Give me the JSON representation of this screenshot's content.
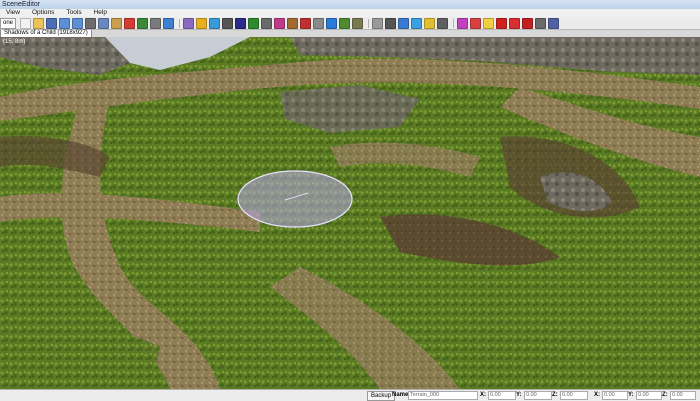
{
  "window": {
    "title": "SceneEditor"
  },
  "menu": [
    "View",
    "Options",
    "Tools",
    "Help"
  ],
  "toolbar": {
    "dropdown_value": "one",
    "buttons": [
      {
        "name": "new-icon",
        "color": "#f2f2f2"
      },
      {
        "name": "open-icon",
        "color": "#e9c35a"
      },
      {
        "name": "save-icon",
        "color": "#4b6fb5"
      },
      {
        "name": "undo-icon",
        "color": "#5d8fd6"
      },
      {
        "name": "redo-icon",
        "color": "#5d8fd6"
      },
      {
        "name": "cut-icon",
        "color": "#6d6d6d"
      },
      {
        "name": "copy-icon",
        "color": "#6a88c0"
      },
      {
        "name": "paste-icon",
        "color": "#caa050"
      },
      {
        "name": "delete-icon",
        "color": "#d53b32"
      },
      {
        "name": "zoom-icon",
        "color": "#3a8a3a"
      },
      {
        "name": "select-icon",
        "color": "#7a7a7a"
      },
      {
        "name": "rotate-icon",
        "color": "#3d7fd1"
      },
      {
        "name": "sep"
      },
      {
        "name": "shapes-icon",
        "color": "#8a6ac0"
      },
      {
        "name": "sun-icon",
        "color": "#e8b020"
      },
      {
        "name": "globe-icon",
        "color": "#3a9ad8"
      },
      {
        "name": "camera-icon",
        "color": "#555"
      },
      {
        "name": "font-icon",
        "color": "#2a2a8a"
      },
      {
        "name": "tree-icon",
        "color": "#2f8a2f"
      },
      {
        "name": "grid-icon",
        "color": "#6a6a6a"
      },
      {
        "name": "paint-icon",
        "color": "#c03a8a"
      },
      {
        "name": "brush-icon",
        "color": "#a06a30"
      },
      {
        "name": "layers-icon",
        "color": "#c03030"
      },
      {
        "name": "rock-icon",
        "color": "#8a8a8a"
      },
      {
        "name": "water-icon",
        "color": "#2a7ad8"
      },
      {
        "name": "terrain-icon",
        "color": "#508a30"
      },
      {
        "name": "mountain-icon",
        "color": "#7a7a50"
      },
      {
        "name": "sep"
      },
      {
        "name": "snap-icon",
        "color": "#9a9a9a"
      },
      {
        "name": "wire-icon",
        "color": "#555"
      },
      {
        "name": "flag-icon",
        "color": "#3a7ad0"
      },
      {
        "name": "sky-icon",
        "color": "#3aa0e0"
      },
      {
        "name": "light-icon",
        "color": "#e0c030"
      },
      {
        "name": "camera2-icon",
        "color": "#606060"
      },
      {
        "name": "sep"
      },
      {
        "name": "player-icon",
        "color": "#c040c0"
      },
      {
        "name": "heart-icon",
        "color": "#d84040"
      },
      {
        "name": "bulb-icon",
        "color": "#f0d040"
      },
      {
        "name": "dot-icon",
        "color": "#d02020"
      },
      {
        "name": "exclaim-icon",
        "color": "#d83030"
      },
      {
        "name": "record-icon",
        "color": "#c02020"
      },
      {
        "name": "script-icon",
        "color": "#6a6a6a"
      },
      {
        "name": "cube-icon",
        "color": "#5060a0"
      }
    ]
  },
  "tab": {
    "label": "Shadows of a Child (1918x927)"
  },
  "viewport": {
    "coords": "(15, 8m)"
  },
  "status": {
    "button_label": "Backup",
    "name_label": "Name:",
    "name_value": "Terrain_000",
    "fields": [
      {
        "label": "X:",
        "value": "0.00"
      },
      {
        "label": "Y:",
        "value": "0.00"
      },
      {
        "label": "Z:",
        "value": "0.00"
      },
      {
        "label": "X:",
        "value": "0.00"
      },
      {
        "label": "Y:",
        "value": "0.00"
      },
      {
        "label": "Z:",
        "value": "0.00"
      }
    ]
  }
}
